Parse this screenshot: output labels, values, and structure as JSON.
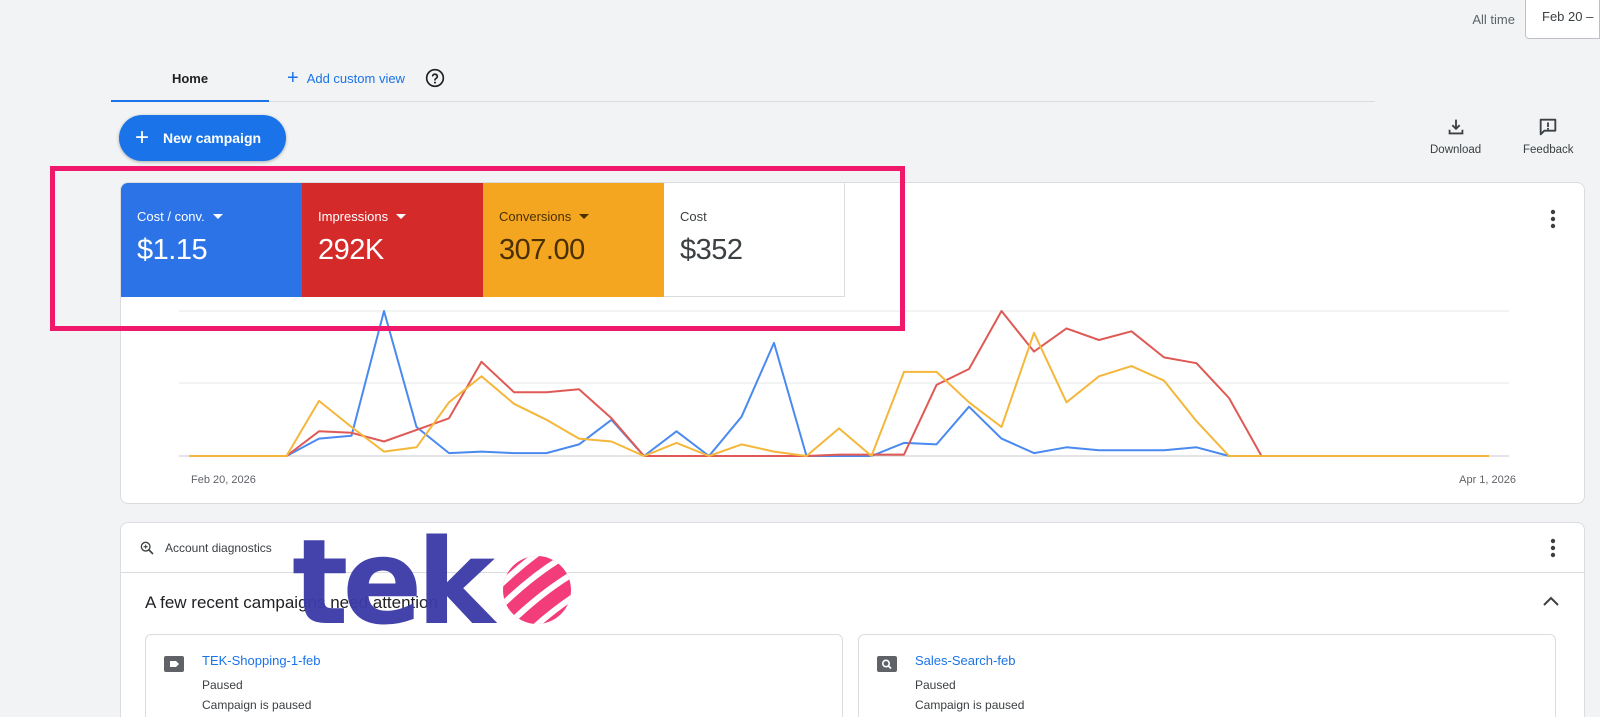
{
  "date_bar": {
    "all_time": "All time",
    "range": "Feb 20 –"
  },
  "tabs": {
    "home": "Home",
    "add_view": "Add custom view"
  },
  "toolbar": {
    "new_campaign": "New campaign",
    "download": "Download",
    "feedback": "Feedback"
  },
  "metrics": [
    {
      "label": "Cost / conv.",
      "value": "$1.15",
      "color": "#2b73e6"
    },
    {
      "label": "Impressions",
      "value": "292K",
      "color": "#d42a2a"
    },
    {
      "label": "Conversions",
      "value": "307.00",
      "color": "#f4a621"
    },
    {
      "label": "Cost",
      "value": "$352",
      "color": "#ffffff"
    }
  ],
  "chart_data": {
    "type": "line",
    "x_start_label": "Feb 20, 2026",
    "x_end_label": "Apr 1, 2026",
    "grid": true,
    "ylim": [
      0,
      100
    ],
    "series": [
      {
        "color": "#4a8af0",
        "values": [
          0,
          0,
          0,
          0,
          12,
          14,
          100,
          20,
          2,
          3,
          2,
          2,
          8,
          25,
          0,
          17,
          0,
          27,
          78,
          0,
          0,
          0,
          9,
          8,
          34,
          12,
          2,
          6,
          4,
          4,
          4,
          6,
          0,
          0,
          0,
          0,
          0,
          0,
          0,
          0,
          0
        ]
      },
      {
        "color": "#df5a55",
        "values": [
          0,
          0,
          0,
          0,
          17,
          16,
          10,
          18,
          26,
          65,
          44,
          44,
          46,
          26,
          0,
          0,
          0,
          0,
          0,
          0,
          1,
          1,
          1,
          49,
          60,
          100,
          72,
          88,
          80,
          86,
          68,
          64,
          40,
          0,
          0,
          0,
          0,
          0,
          0,
          0,
          0
        ]
      },
      {
        "color": "#f5b73b",
        "values": [
          0,
          0,
          0,
          0,
          38,
          20,
          3,
          6,
          37,
          55,
          36,
          25,
          12,
          10,
          0,
          9,
          0,
          8,
          3,
          0,
          19,
          0,
          58,
          58,
          37,
          20,
          85,
          37,
          55,
          62,
          52,
          24,
          0,
          0,
          0,
          0,
          0,
          0,
          0,
          0,
          0
        ]
      }
    ]
  },
  "diagnostics": {
    "header": "Account diagnostics",
    "title": "A few recent campaigns need attention",
    "campaigns": [
      {
        "name": "TEK-Shopping-1-feb",
        "status": "Paused",
        "detail": "Campaign is paused"
      },
      {
        "name": "Sales-Search-feb",
        "status": "Paused",
        "detail": "Campaign is paused"
      }
    ]
  },
  "logo": {
    "text": "tek"
  },
  "colors": {
    "accent": "#1a73e8",
    "highlight": "#f0186a",
    "logo": "#3c3ca8",
    "logo_mark": "#f23d7a"
  }
}
